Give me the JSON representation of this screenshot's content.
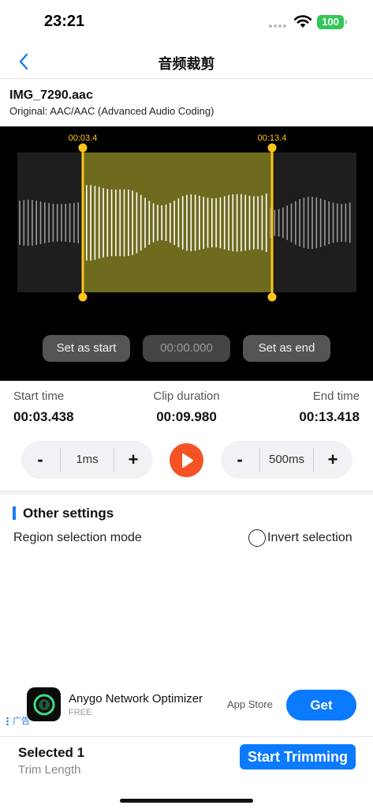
{
  "status": {
    "time": "23:21",
    "battery": "100"
  },
  "nav": {
    "title": "音频裁剪"
  },
  "file": {
    "name": "IMG_7290.aac",
    "original": "Original: AAC/AAC (Advanced Audio Coding)"
  },
  "trimmer": {
    "start_marker": "00:03.4",
    "end_marker": "00:13.4",
    "set_start_label": "Set as start",
    "position_value": "00:00.000",
    "set_end_label": "Set as end",
    "colors": {
      "selection": "#6e6a1e",
      "handle": "#ffc619",
      "wave": "#ffffff",
      "unselected_wave": "#9a9a9a"
    }
  },
  "times": {
    "start_label": "Start time",
    "start_value": "00:03.438",
    "duration_label": "Clip duration",
    "duration_value": "00:09.980",
    "end_label": "End time",
    "end_value": "00:13.418"
  },
  "steppers": {
    "left": {
      "minus": "-",
      "value": "1ms",
      "plus": "+"
    },
    "right": {
      "minus": "-",
      "value": "500ms",
      "plus": "+"
    }
  },
  "settings": {
    "title": "Other settings",
    "region_mode_label": "Region selection mode",
    "invert_label": "Invert selection"
  },
  "ad": {
    "badge": "广告",
    "app_name": "Anygo Network Optimizer",
    "price": "FREE",
    "store": "App Store",
    "cta": "Get"
  },
  "bottom": {
    "selected": "Selected 1",
    "trim_length": "Trim Length",
    "start_button": "Start Trimming"
  }
}
